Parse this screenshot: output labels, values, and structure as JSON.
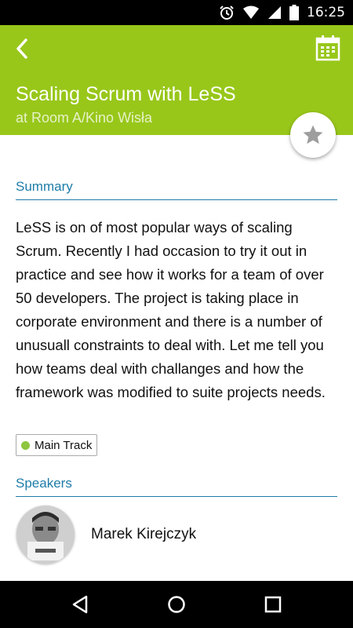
{
  "status_bar": {
    "time": "16:25",
    "icons": [
      "alarm-icon",
      "wifi-icon",
      "signal-icon",
      "battery-icon"
    ]
  },
  "toolbar": {
    "title": "Scaling Scrum with LeSS",
    "subtitle": "at Room A/Kino Wisła",
    "background_color": "#98c71a",
    "back_icon": "chevron-left-icon",
    "calendar_icon": "calendar-icon"
  },
  "favorite": {
    "icon": "star-icon"
  },
  "summary": {
    "header": "Summary",
    "text": "LeSS is on of most popular ways of scaling Scrum. Recently I had occasion to try it out in practice and see how it works for a team of over 50 developers. The project is taking place in corporate environment and there is a number of unusuall constraints to deal with. Let me tell you how teams deal with challanges and how the framework was modified to suite projects needs."
  },
  "track": {
    "label": "Main Track",
    "color": "#8dc63f"
  },
  "speakers": {
    "header": "Speakers",
    "items": [
      {
        "name": "Marek Kirejczyk"
      }
    ]
  },
  "nav_bar": {
    "icons": [
      "back-triangle-icon",
      "home-circle-icon",
      "recents-square-icon"
    ]
  },
  "accent_color": "#1d7ca8"
}
